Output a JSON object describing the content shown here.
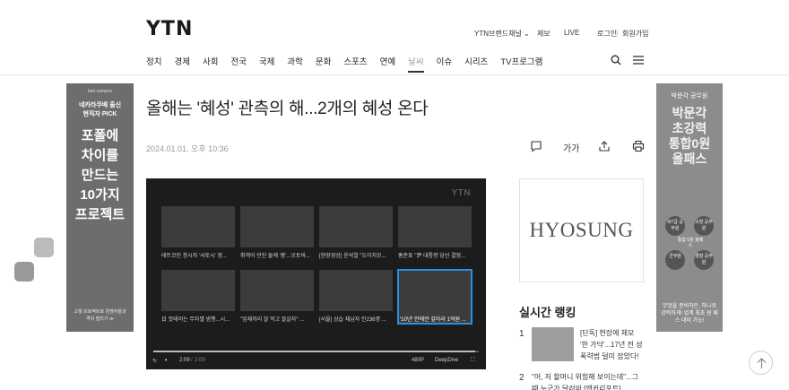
{
  "logo": "YTN",
  "util_links": [
    "YTN브랜드채널",
    "제보",
    "LIVE",
    "로그인",
    "회원가입"
  ],
  "nav": [
    "정치",
    "경제",
    "사회",
    "전국",
    "국제",
    "과학",
    "문화",
    "스포츠",
    "연예",
    "날씨",
    "이슈",
    "시리즈",
    "TV프로그램"
  ],
  "nav_active": "날씨",
  "article": {
    "headline": "올해는 '혜성' 관측의 해...2개의 혜성 온다",
    "date": "2024.01.01. 오후 10:36",
    "font_size_label": "가가"
  },
  "ad_left": {
    "brand": "fast campus",
    "line1": "네카라쿠배 출신",
    "line2": "현직자 PICK",
    "big": [
      "포폴에",
      "차이를",
      "만드는",
      "10가지",
      "프로젝트"
    ],
    "bottom": "고퀄 프로젝트로 경쟁자들과 격차 벌리기 ≫"
  },
  "ad_right": {
    "top": "박문각 공무원",
    "big": [
      "박문각",
      "초강력",
      "통합0원",
      "올패스"
    ],
    "circles": [
      "9/7급 공무원",
      "소방 공무원",
      "군무원",
      "경찰 공무원"
    ],
    "center": "통합 0원 올패스",
    "bottom": "무엇을 준비하든, 하나로 강력하게! 업계 최초 원 패스 대비 가능!"
  },
  "video": {
    "logo": "YTN",
    "current_time": "2:09",
    "total_time": "2:09",
    "progress": 0.99,
    "quality": "480P",
    "deepdive_label": "DeepDive",
    "thumbs": [
      "테트코인 창시자 '사토시' 정...",
      "취객이 던진 돌에 '쾅'...오토바...",
      "[현장영상] 윤석열 \"도이치모...",
      "홍준표 \"尹 대통령 당선 결정...",
      "日 맛태러는 무차별 범행...시...",
      "\"업체까리 잘 먹고 잘살자\" ...",
      "[서울] 상습 체납자 인236명 ...",
      "'10년' 안에만 갚아라 1억원 ..."
    ]
  },
  "sponsor": "HYOSUNG",
  "ranking": {
    "title": "실시간 랭킹",
    "items": [
      {
        "num": "1",
        "text": "[단독] 현장에 체모 '한 가닥'...17년 전 성폭력범 덜미 잡았다!"
      },
      {
        "num": "2",
        "text": "\"어, 저 할머니 위험해 보이는데\"...그때 누군가 달려와 [앤커리포트]"
      }
    ]
  }
}
